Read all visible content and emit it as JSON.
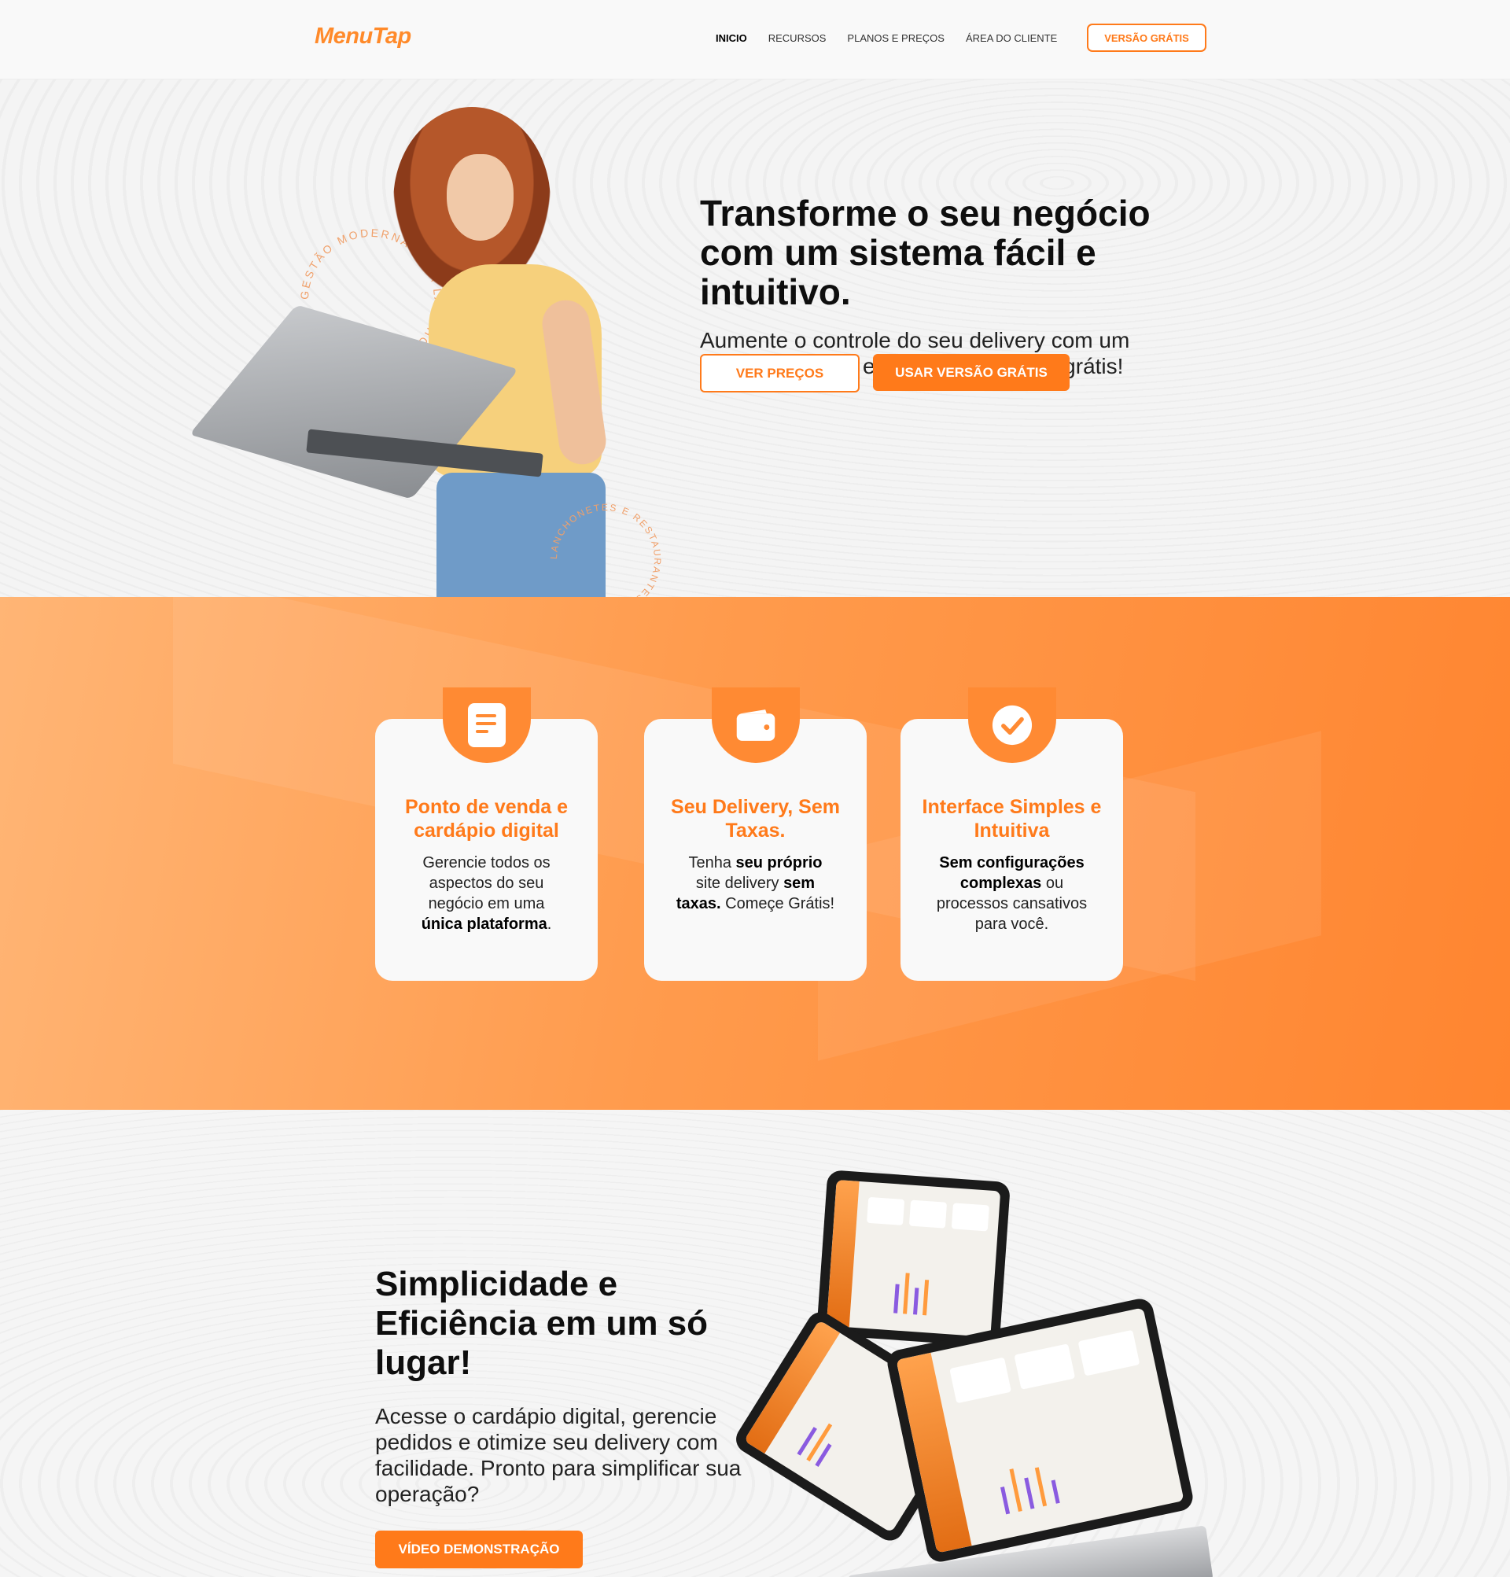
{
  "header": {
    "logo": "MenuTap",
    "nav": [
      "INICIO",
      "RECURSOS",
      "PLANOS E PREÇOS",
      "ÁREA DO CLIENTE"
    ],
    "cta": "VERSÃO GRÁTIS"
  },
  "hero": {
    "title": "Transforme o seu negócio com um sistema fácil e intuitivo.",
    "subtitle": "Aumente o controle do seu delivery com um sistema simples e eficiente. Comece grátis!",
    "btn_prices": "VER PREÇOS",
    "btn_free": "USAR VERSÃO GRÁTIS",
    "badge_text_1": "GESTÃO MODERNA PARA LANCHONETES",
    "badge_text_2": "LANCHONETES E RESTAURANTES"
  },
  "features": [
    {
      "icon": "document-icon",
      "title": "Ponto de venda e cardápio digital",
      "body_1": "Gerencie todos os aspectos do seu negócio em uma ",
      "body_bold": "única plataforma",
      "body_2": "."
    },
    {
      "icon": "wallet-icon",
      "title": "Seu Delivery, Sem Taxas.",
      "body_1": "Tenha ",
      "body_bold": "seu próprio",
      "body_2": " site delivery ",
      "body_bold_2": "sem taxas.",
      "body_3": " Começe Grátis!"
    },
    {
      "icon": "check-circle-icon",
      "title": "Interface Simples e Intuitiva",
      "body_bold": "Sem configurações complexas",
      "body_1": " ou processos cansativos para você."
    }
  ],
  "bottom": {
    "title": "Simplicidade e Eficiência em um só lugar!",
    "subtitle": "Acesse o cardápio digital, gerencie pedidos e otimize seu delivery com facilidade. Pronto para simplificar sua operação?",
    "btn_video": "VÍDEO DEMONSTRAÇÃO"
  },
  "colors": {
    "accent": "#ff7a1a",
    "accent_light": "#ffb575"
  }
}
